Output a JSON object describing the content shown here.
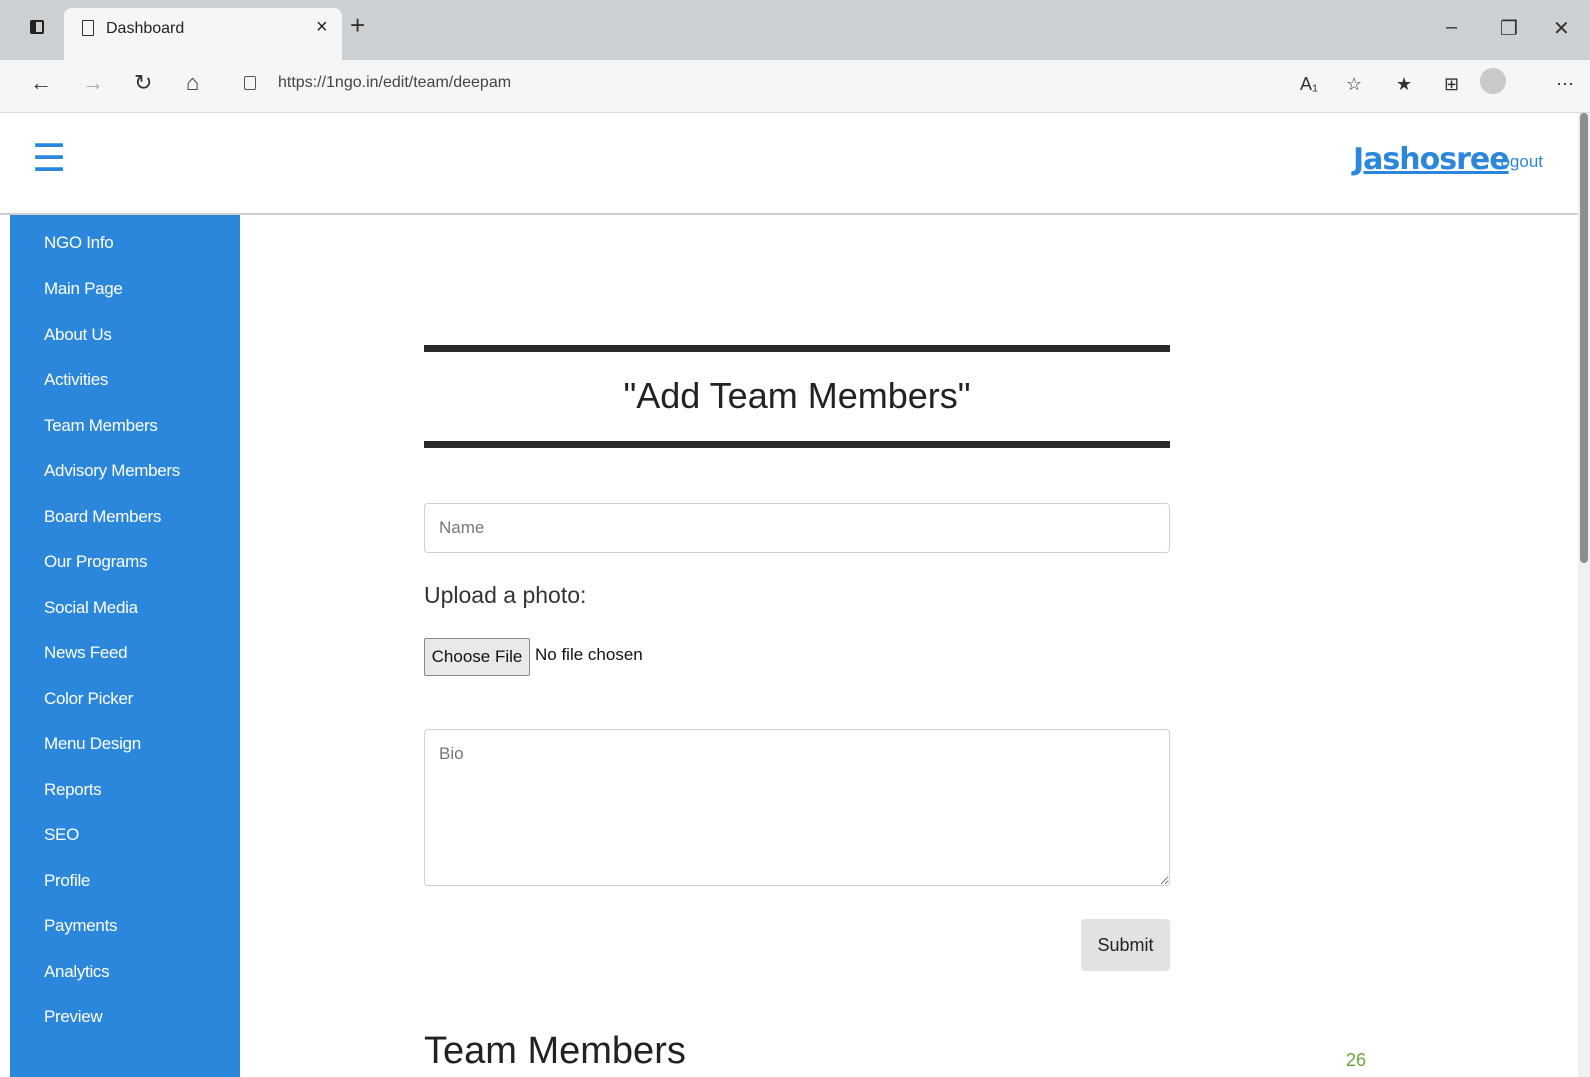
{
  "browser": {
    "tab_title": "Dashboard",
    "tab_close": "×",
    "new_tab": "+",
    "url_host": "https://1ngo.in",
    "url_path": "/edit/team/deepam",
    "icons": [
      "sidebar-toggle-icon",
      "page-icon",
      "back-icon",
      "forward-icon",
      "refresh-icon",
      "home-icon",
      "lock-icon",
      "read-aloud-icon",
      "add-favorite-icon",
      "favorites-icon",
      "collections-icon",
      "profile-icon",
      "more-icon",
      "minimize-icon",
      "restore-icon",
      "close-icon"
    ]
  },
  "header": {
    "username": "Jashosree",
    "logout": "Logout"
  },
  "sidebar": {
    "items": [
      {
        "label": "NGO Info"
      },
      {
        "label": "Main Page"
      },
      {
        "label": "About Us"
      },
      {
        "label": "Activities"
      },
      {
        "label": "Team Members"
      },
      {
        "label": "Advisory Members"
      },
      {
        "label": "Board Members"
      },
      {
        "label": "Our Programs"
      },
      {
        "label": "Social Media"
      },
      {
        "label": "News Feed"
      },
      {
        "label": "Color Picker"
      },
      {
        "label": "Menu Design"
      },
      {
        "label": "Reports"
      },
      {
        "label": "SEO"
      },
      {
        "label": "Profile"
      },
      {
        "label": "Payments"
      },
      {
        "label": "Analytics"
      },
      {
        "label": "Preview"
      }
    ]
  },
  "form": {
    "title": "\"Add Team Members\"",
    "name_placeholder": "Name",
    "upload_label": "Upload a photo:",
    "choose_file": "Choose File",
    "file_status": "No file chosen",
    "bio_placeholder": "Bio",
    "submit": "Submit"
  },
  "section": {
    "title": "Team Members"
  },
  "page_number": "26",
  "colors": {
    "accent": "#2b87dc",
    "sidebar_bg": "#2b87dc",
    "page_number": "#6aa43a"
  }
}
